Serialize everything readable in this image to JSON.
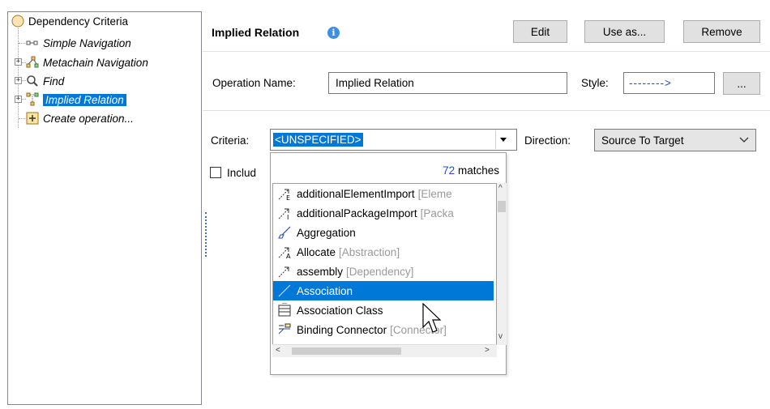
{
  "tree": {
    "root": "Dependency Criteria",
    "items": [
      {
        "label": "Simple Navigation",
        "icon": "simple-navigation-icon"
      },
      {
        "label": "Metachain Navigation",
        "icon": "metachain-navigation-icon"
      },
      {
        "label": "Find",
        "icon": "search-icon"
      },
      {
        "label": "Implied Relation",
        "icon": "implied-relation-icon",
        "selected": true
      },
      {
        "label": "Create operation...",
        "icon": "plus-icon"
      }
    ]
  },
  "header": {
    "title": "Implied Relation",
    "edit": "Edit",
    "use_as": "Use as...",
    "remove": "Remove"
  },
  "operation": {
    "name_label": "Operation Name:",
    "name_value": "Implied Relation",
    "style_label": "Style:",
    "style_value": "-------->",
    "more": "..."
  },
  "criteria": {
    "label": "Criteria:",
    "value": "<UNSPECIFIED>",
    "direction_label": "Direction:",
    "direction_value": "Source To Target",
    "include_label": "Includ"
  },
  "popup": {
    "matches_count": "72",
    "matches_text": "matches",
    "items": [
      {
        "name": "additionalElementImport",
        "meta": "[Eleme",
        "icon": "element-import-icon"
      },
      {
        "name": "additionalPackageImport",
        "meta": "[Packa",
        "icon": "package-import-icon"
      },
      {
        "name": "Aggregation",
        "meta": "",
        "icon": "aggregation-icon"
      },
      {
        "name": "Allocate",
        "meta": "[Abstraction]",
        "icon": "allocate-icon"
      },
      {
        "name": "assembly",
        "meta": "[Dependency]",
        "icon": "dependency-icon"
      },
      {
        "name": "Association",
        "meta": "",
        "icon": "association-icon",
        "selected": true
      },
      {
        "name": "Association Class",
        "meta": "",
        "icon": "association-class-icon"
      },
      {
        "name": "Binding Connector",
        "meta": "[Connector]",
        "icon": "binding-connector-icon"
      }
    ]
  },
  "colors": {
    "selection": "#0078d7",
    "matches_count": "#1a4fd1",
    "info_icon": "#3d8fe0"
  }
}
